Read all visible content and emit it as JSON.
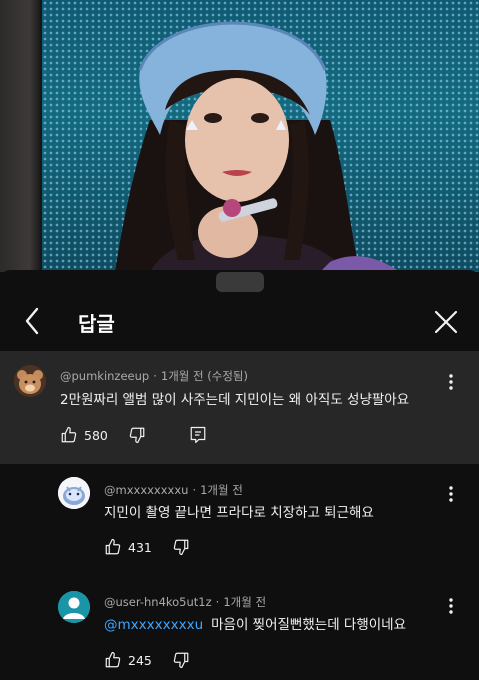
{
  "header": {
    "title": "답글"
  },
  "parent_comment": {
    "author": "@pumkinzeeup",
    "time": "1개월 전",
    "edited": "(수정됨)",
    "text": "2만원짜리 앨범 많이 사주는데 지민이는 왜 아직도 성냥팔아요",
    "likes": "580"
  },
  "replies": [
    {
      "author": "@mxxxxxxxxu",
      "time": "1개월 전",
      "mention": "",
      "text": "지민이 촬영 끝나면 프라다로 치장하고 퇴근해요",
      "likes": "431"
    },
    {
      "author": "@user-hn4ko5ut1z",
      "time": "1개월 전",
      "mention": "@mxxxxxxxxu",
      "text": "마음이 찢어질뻔했는데 다행이네요",
      "likes": "245"
    }
  ],
  "icons": {
    "back": "chevron-left-icon",
    "close": "close-icon",
    "like": "thumb-up-icon",
    "dislike": "thumb-down-icon",
    "reply": "reply-icon",
    "more": "more-vert-icon"
  },
  "colors": {
    "background": "#0f0f0f",
    "highlight": "#272727",
    "mention": "#3ea6ff",
    "reply2_avatar": "#1a95a8"
  }
}
